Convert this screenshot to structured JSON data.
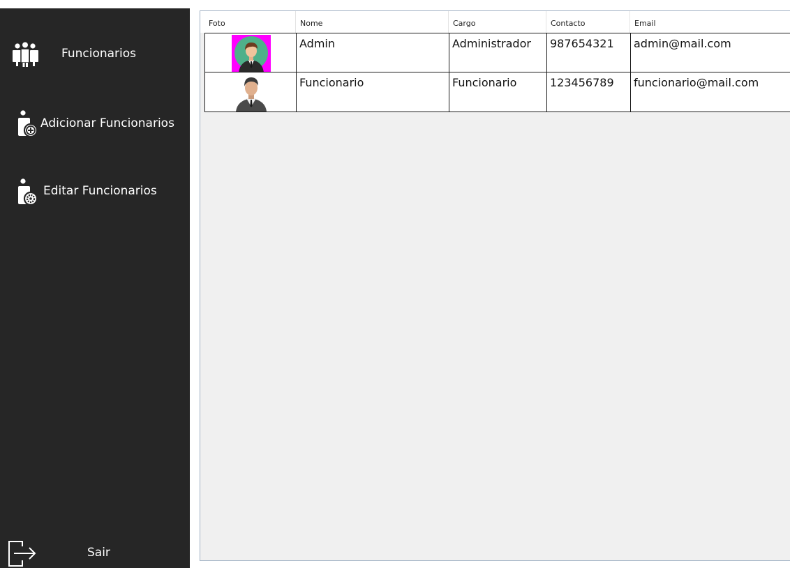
{
  "sidebar": {
    "items": [
      {
        "label": "Funcionarios",
        "icon": "users-group-icon"
      },
      {
        "label": "Adicionar Funcionarios",
        "icon": "user-add-icon"
      },
      {
        "label": "Editar Funcionarios",
        "icon": "user-settings-icon"
      }
    ],
    "logout": {
      "label": "Sair",
      "icon": "logout-icon"
    }
  },
  "grid": {
    "columns": [
      "Foto",
      "Nome",
      "Cargo",
      "Contacto",
      "Email"
    ],
    "rows": [
      {
        "photo": "admin-avatar",
        "nome": "Admin",
        "cargo": "Administrador",
        "contacto": "987654321",
        "email": "admin@mail.com"
      },
      {
        "photo": "employee-avatar",
        "nome": "Funcionario",
        "cargo": "Funcionario",
        "contacto": "123456789",
        "email": "funcionario@mail.com"
      }
    ]
  },
  "colors": {
    "sidebar_bg": "#262626",
    "grid_bg": "#f0f0f0",
    "grid_border": "#9fb0c3",
    "avatar_highlight": "#ff00ff",
    "avatar_circle": "#4fb08a"
  }
}
